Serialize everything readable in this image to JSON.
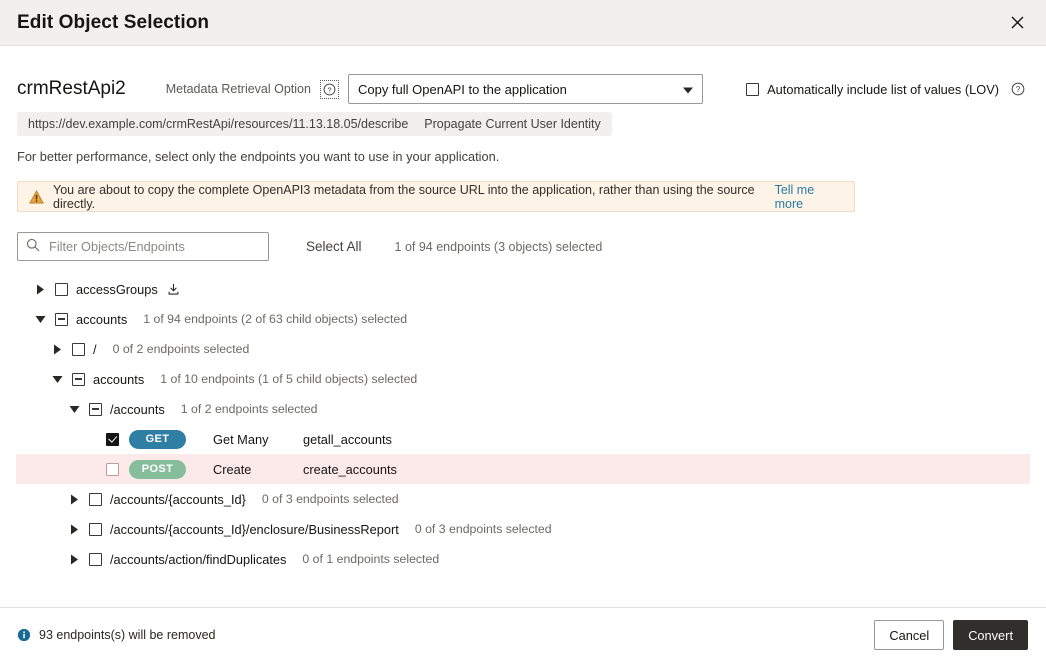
{
  "dialog": {
    "title": "Edit Object Selection",
    "close_icon": "close-icon"
  },
  "header": {
    "api_name": "crmRestApi2",
    "metadata_option_label": "Metadata Retrieval Option",
    "metadata_option_help_icon": "help-circle-icon",
    "metadata_option_value": "Copy full OpenAPI to the application",
    "lov_checkbox_label": "Automatically include list of values (LOV)",
    "lov_checked": false,
    "lov_help_icon": "help-circle-icon"
  },
  "source": {
    "url": "https://dev.example.com/crmRestApi/resources/11.13.18.05/describe",
    "separator": "·",
    "identity": "Propagate Current User Identity",
    "hint": "For better performance, select only the endpoints you want to use in your application."
  },
  "warning": {
    "icon": "warning-triangle-icon",
    "text": "You are about to copy the complete OpenAPI3 metadata from the source URL into the application, rather than using the source directly.",
    "link_label": "Tell me more"
  },
  "filter": {
    "search_icon": "search-icon",
    "search_value": "",
    "search_placeholder": "Filter Objects/Endpoints",
    "select_all_label": "Select All",
    "selection_summary": "1 of 94 endpoints (3 objects) selected"
  },
  "tree": {
    "rows": [
      {
        "indent": 0,
        "twisty": "collapsed",
        "checkbox": "unchecked",
        "label": "accessGroups",
        "count": "",
        "download_icon": "download-icon",
        "type": "node",
        "highlight": false
      },
      {
        "indent": 0,
        "twisty": "expanded",
        "checkbox": "indeterminate",
        "label": "accounts",
        "count": "1 of 94 endpoints (2 of 63 child objects) selected",
        "download_icon": "",
        "type": "node",
        "highlight": false
      },
      {
        "indent": 1,
        "twisty": "collapsed",
        "checkbox": "unchecked",
        "label": "/",
        "count": "0 of 2 endpoints selected",
        "download_icon": "",
        "type": "node",
        "highlight": false
      },
      {
        "indent": 1,
        "twisty": "expanded",
        "checkbox": "indeterminate",
        "label": "accounts",
        "count": "1 of 10 endpoints (1 of 5 child objects) selected",
        "download_icon": "",
        "type": "node",
        "highlight": false
      },
      {
        "indent": 2,
        "twisty": "expanded",
        "checkbox": "indeterminate",
        "label": "/accounts",
        "count": "1 of 2 endpoints selected",
        "download_icon": "",
        "type": "node",
        "highlight": false
      },
      {
        "indent": 3,
        "twisty": "none",
        "checkbox": "checked",
        "method": "GET",
        "method_color": "#2f7ea4",
        "op_name": "Get Many",
        "op_id": "getall_accounts",
        "type": "endpoint",
        "highlight": false
      },
      {
        "indent": 3,
        "twisty": "none",
        "checkbox": "unchecked-pink",
        "method": "POST",
        "method_color": "#86bd9a",
        "op_name": "Create",
        "op_id": "create_accounts",
        "type": "endpoint",
        "highlight": true
      },
      {
        "indent": 2,
        "twisty": "collapsed",
        "checkbox": "unchecked",
        "label": "/accounts/{accounts_Id}",
        "count": "0 of 3 endpoints selected",
        "download_icon": "",
        "type": "node",
        "highlight": false
      },
      {
        "indent": 2,
        "twisty": "collapsed",
        "checkbox": "unchecked",
        "label": "/accounts/{accounts_Id}/enclosure/BusinessReport",
        "count": "0 of 3 endpoints selected",
        "download_icon": "",
        "type": "node",
        "highlight": false
      },
      {
        "indent": 2,
        "twisty": "collapsed",
        "checkbox": "unchecked",
        "label": "/accounts/action/findDuplicates",
        "count": "0 of 1 endpoints selected",
        "download_icon": "",
        "type": "node",
        "highlight": false
      }
    ]
  },
  "footer": {
    "info_icon": "info-circle-icon",
    "note": "93 endpoints(s) will be removed",
    "cancel_label": "Cancel",
    "convert_label": "Convert"
  },
  "colors": {
    "get_badge": "#2f7ea4",
    "post_badge": "#86bd9a",
    "highlight_row": "#fceaea",
    "warning_bg": "#fdf3e7",
    "link": "#2a7ba8",
    "primary_button": "#312f2c"
  }
}
